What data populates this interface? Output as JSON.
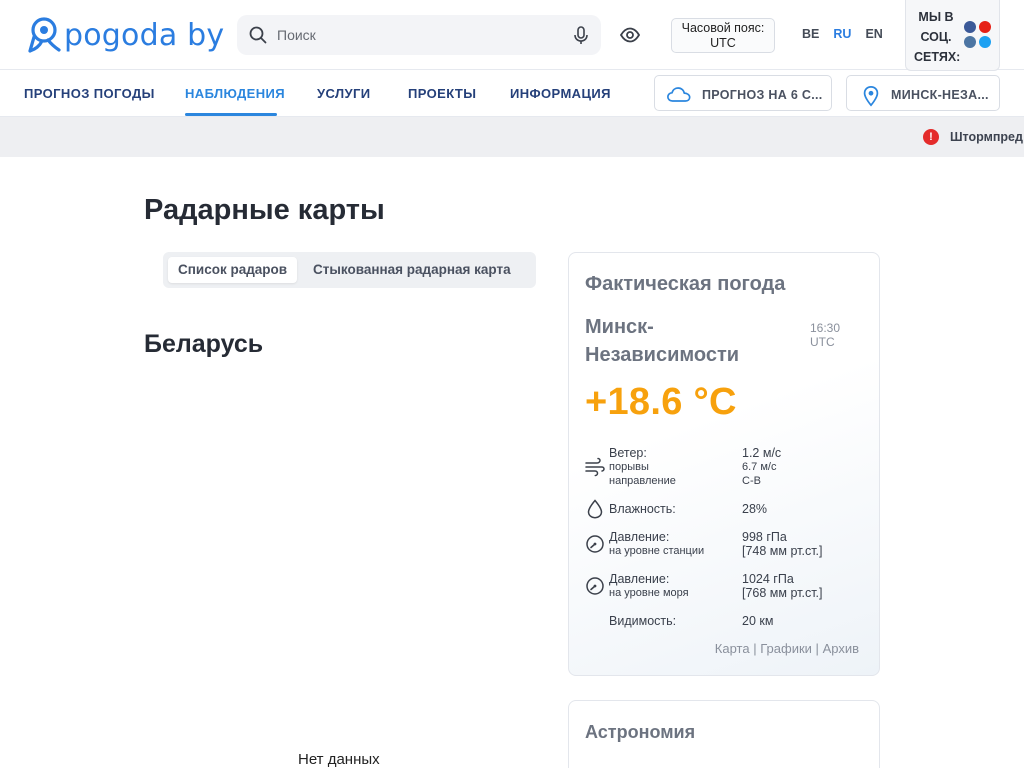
{
  "header": {
    "logo_text": "pogoda by",
    "search_placeholder": "Поиск",
    "timezone_line1": "Часовой пояс:",
    "timezone_line2": "UTC",
    "languages": [
      {
        "code": "BE",
        "active": false
      },
      {
        "code": "RU",
        "active": true
      },
      {
        "code": "EN",
        "active": false
      }
    ],
    "social_label_lines": [
      "МЫ В",
      "СОЦ.",
      "СЕТЯХ:"
    ],
    "social_icons": [
      "facebook-icon",
      "youtube-icon",
      "vk-icon",
      "twitter-icon"
    ]
  },
  "nav": {
    "items": [
      {
        "label": "ПРОГНОЗ ПОГОДЫ",
        "active": false
      },
      {
        "label": "НАБЛЮДЕНИЯ",
        "active": true
      },
      {
        "label": "УСЛУГИ",
        "active": false
      },
      {
        "label": "ПРОЕКТЫ",
        "active": false
      },
      {
        "label": "ИНФОРМАЦИЯ",
        "active": false
      }
    ],
    "forecast_button": "ПРОГНОЗ НА 6 С...",
    "location_button": "МИНСК-НЕЗА..."
  },
  "alert": {
    "text": "Штормпред"
  },
  "main": {
    "title": "Радарные карты",
    "tabs": [
      {
        "label": "Список радаров",
        "active": true
      },
      {
        "label": "Стыкованная радарная карта",
        "active": false
      }
    ],
    "country": "Беларусь",
    "no_data": "Нет данных"
  },
  "weather": {
    "title": "Фактическая погода",
    "station": "Минск-Независимости",
    "time_line1": "16:30",
    "time_line2": "UTC",
    "temperature": "+18.6 °C",
    "wind_label": "Ветер:",
    "wind_gust_label": "порывы",
    "wind_dir_label": "направление",
    "wind_value": "1.2 м/с",
    "wind_gust_value": "6.7 м/с",
    "wind_dir_value": "С-В",
    "humidity_label": "Влажность:",
    "humidity_value": "28%",
    "pressure_label": "Давление:",
    "pressure_station_sub": "на уровне станции",
    "pressure_station_value": "998 гПа",
    "pressure_station_mm": "[748 мм рт.ст.]",
    "pressure_sea_sub": "на уровне моря",
    "pressure_sea_value": "1024 гПа",
    "pressure_sea_mm": "[768 мм рт.ст.]",
    "visibility_label": "Видимость:",
    "visibility_value": "20 км",
    "links": [
      "Карта",
      "Графики",
      "Архив"
    ],
    "separator": "|"
  },
  "astronomy": {
    "title": "Астрономия"
  },
  "colors": {
    "brand": "#2b7de0",
    "temperature": "#f7a10d",
    "alert": "#e42b2b"
  }
}
